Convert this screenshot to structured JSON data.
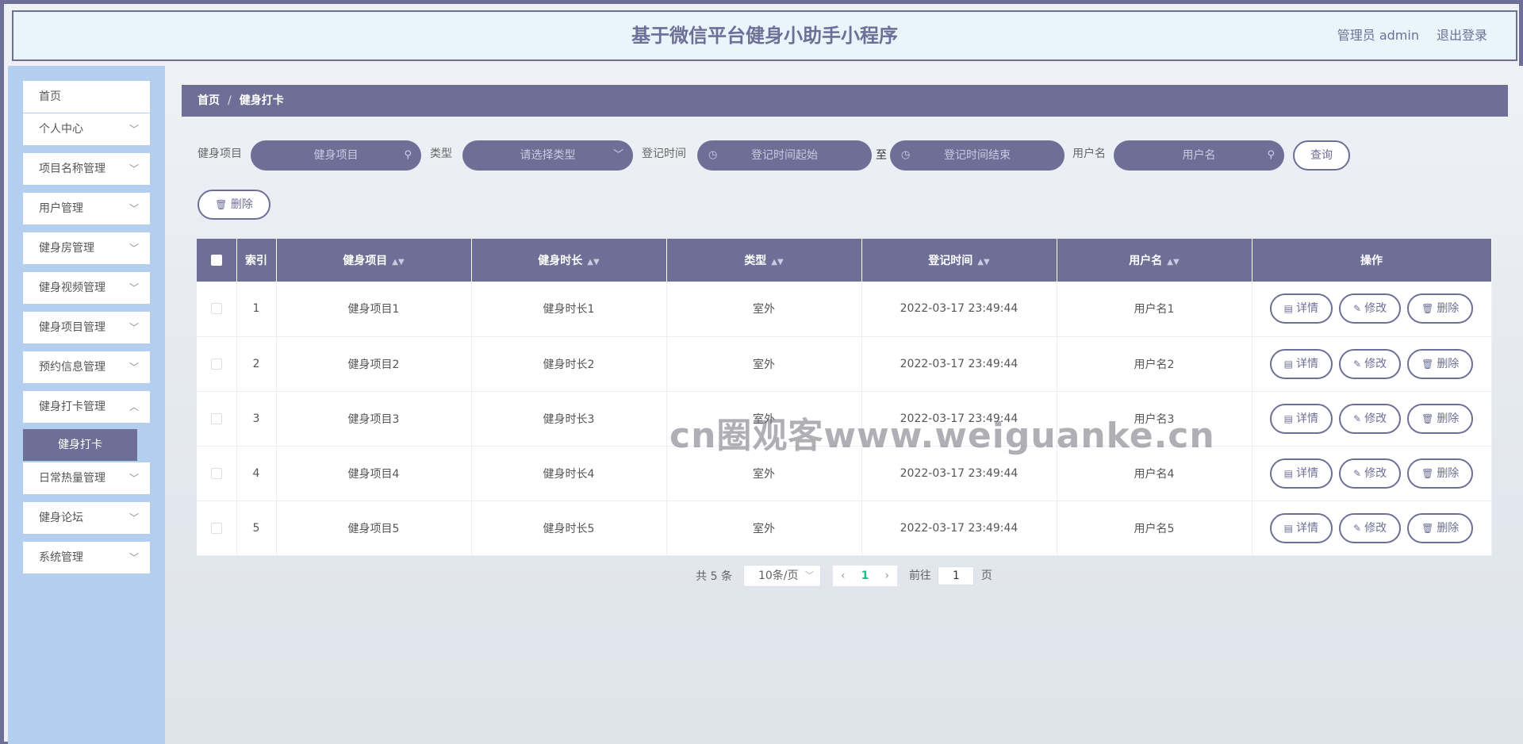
{
  "header": {
    "title": "基于微信平台健身小助手小程序",
    "user": "管理员 admin",
    "logout": "退出登录"
  },
  "sidebar": {
    "items": [
      {
        "label": "首页",
        "has_children": false
      },
      {
        "label": "个人中心",
        "has_children": true
      },
      {
        "label": "项目名称管理",
        "has_children": true
      },
      {
        "label": "用户管理",
        "has_children": true
      },
      {
        "label": "健身房管理",
        "has_children": true
      },
      {
        "label": "健身视频管理",
        "has_children": true
      },
      {
        "label": "健身项目管理",
        "has_children": true
      },
      {
        "label": "预约信息管理",
        "has_children": true
      },
      {
        "label": "健身打卡管理",
        "has_children": true
      },
      {
        "label": "日常热量管理",
        "has_children": true
      },
      {
        "label": "健身论坛",
        "has_children": true
      },
      {
        "label": "系统管理",
        "has_children": true
      }
    ],
    "active_sub": "健身打卡"
  },
  "breadcrumb": {
    "home": "首页",
    "separator": "/",
    "current": "健身打卡"
  },
  "search": {
    "project_label": "健身项目",
    "project_placeholder": "健身项目",
    "type_label": "类型",
    "type_placeholder": "请选择类型",
    "time_label": "登记时间",
    "time_start_placeholder": "登记时间起始",
    "time_to": "至",
    "time_end_placeholder": "登记时间结束",
    "username_label": "用户名",
    "username_placeholder": "用户名",
    "query_button": "查询",
    "delete_button": "删除"
  },
  "table": {
    "columns": [
      "索引",
      "健身项目",
      "健身时长",
      "类型",
      "登记时间",
      "用户名",
      "操作"
    ],
    "rows": [
      {
        "index": "1",
        "project": "健身项目1",
        "duration": "健身时长1",
        "type": "室外",
        "time": "2022-03-17 23:49:44",
        "username": "用户名1"
      },
      {
        "index": "2",
        "project": "健身项目2",
        "duration": "健身时长2",
        "type": "室外",
        "time": "2022-03-17 23:49:44",
        "username": "用户名2"
      },
      {
        "index": "3",
        "project": "健身项目3",
        "duration": "健身时长3",
        "type": "室外",
        "time": "2022-03-17 23:49:44",
        "username": "用户名3"
      },
      {
        "index": "4",
        "project": "健身项目4",
        "duration": "健身时长4",
        "type": "室外",
        "time": "2022-03-17 23:49:44",
        "username": "用户名4"
      },
      {
        "index": "5",
        "project": "健身项目5",
        "duration": "健身时长5",
        "type": "室外",
        "time": "2022-03-17 23:49:44",
        "username": "用户名5"
      }
    ],
    "actions": {
      "detail": "详情",
      "edit": "修改",
      "delete": "删除"
    }
  },
  "pagination": {
    "total": "共 5 条",
    "page_size": "10条/页",
    "current_page": "1",
    "goto_prefix": "前往",
    "goto_value": "1",
    "goto_suffix": "页"
  },
  "watermark": "cn圈观客www.weiguanke.cn",
  "colors": {
    "accent": "#6e6f96",
    "sidebar_bg": "#b4ceef",
    "header_bg": "#e8f6fc",
    "page_active": "#1bbd8a"
  }
}
